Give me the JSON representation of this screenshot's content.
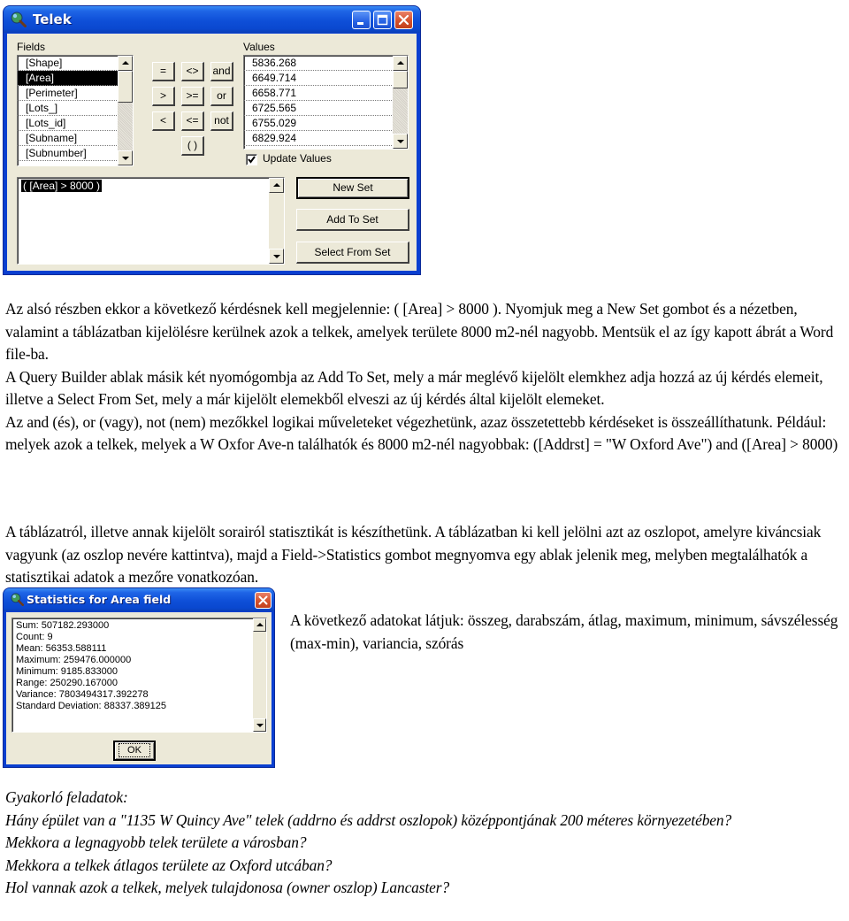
{
  "query_window": {
    "title": "Telek",
    "icon": "query-magnifier-globe-icon",
    "caption_buttons": [
      "minimize-icon",
      "maximize-icon",
      "close-icon"
    ],
    "fields_label": "Fields",
    "fields": [
      "[Shape]",
      "[Area]",
      "[Perimeter]",
      "[Lots_]",
      "[Lots_id]",
      "[Subname]",
      "[Subnumber]"
    ],
    "selected_field": "[Area]",
    "operators": [
      [
        "=",
        "<>",
        "and"
      ],
      [
        ">",
        ">=",
        "or"
      ],
      [
        "<",
        "<=",
        "not"
      ],
      [
        "( )"
      ]
    ],
    "values_label": "Values",
    "values": [
      "5836.268",
      "6649.714",
      "6658.771",
      "6725.565",
      "6755.029",
      "6829.924"
    ],
    "update_values_label": "Update Values",
    "update_values_checked": true,
    "expression": "( [Area] > 8000 )",
    "buttons": {
      "new_set": "New Set",
      "add_to_set": "Add To Set",
      "select_from_set": "Select From Set"
    }
  },
  "text": {
    "p1": "Az alsó részben ekkor a következő kérdésnek kell megjelennie: ( [Area] > 8000 ). Nyomjuk meg a New Set gombot és a nézetben, valamint a táblázatban kijelölésre kerülnek azok a telkek, amelyek területe 8000 m2-nél nagyobb. Mentsük el az így kapott ábrát a Word file-ba.",
    "p2": "A Query Builder ablak másik két nyomógombja az Add To Set, mely a már meglévő kijelölt elemkhez adja hozzá az új kérdés elemeit, illetve a Select From Set, mely a már kijelölt elemekből elveszi az új kérdés által kijelölt elemeket.",
    "p3": "Az and (és), or (vagy), not (nem) mezőkkel logikai műveleteket végezhetünk, azaz összetettebb kérdéseket is összeállíthatunk. Például: melyek azok a telkek, melyek a W Oxfor Ave-n találhatók és 8000 m2-nél nagyobbak: ([Addrst]  =  \"W Oxford Ave\") and ([Area] > 8000)",
    "p4": "A táblázatról, illetve annak kijelölt sorairól statisztikát is készíthetünk. A táblázatban ki kell jelölni azt az oszlopot, amelyre kiváncsiak vagyunk (az oszlop nevére kattintva), majd a Field->Statistics gombot megnyomva egy ablak jelenik meg, melyben megtalálhatók a statisztikai adatok a mezőre vonatkozóan.",
    "p5": "A következő adatokat látjuk: összeg, darabszám, átlag, maximum, minimum, sávszélesség (max-min), variancia, szórás"
  },
  "stats_window": {
    "title": "Statistics for Area field",
    "icon": "query-magnifier-globe-icon",
    "lines": [
      "Sum: 507182.293000",
      "Count: 9",
      "Mean: 56353.588111",
      "Maximum: 259476.000000",
      "Minimum: 9185.833000",
      "Range: 250290.167000",
      "Variance: 7803494317.392278",
      "Standard Deviation: 88337.389125"
    ],
    "ok_label": "OK"
  },
  "exercises": {
    "heading": "Gyakorló feladatok:",
    "items": [
      "Hány épület van a \"1135 W Quincy Ave\" telek (addrno és addrst oszlopok) középpontjának 200 méteres környezetében?",
      "Mekkora a legnagyobb telek területe a városban?",
      "Mekkora a telkek átlagos területe az Oxford utcában?",
      "Hol vannak azok a telkek, melyek tulajdonosa (owner oszlop) Lancaster?"
    ]
  }
}
